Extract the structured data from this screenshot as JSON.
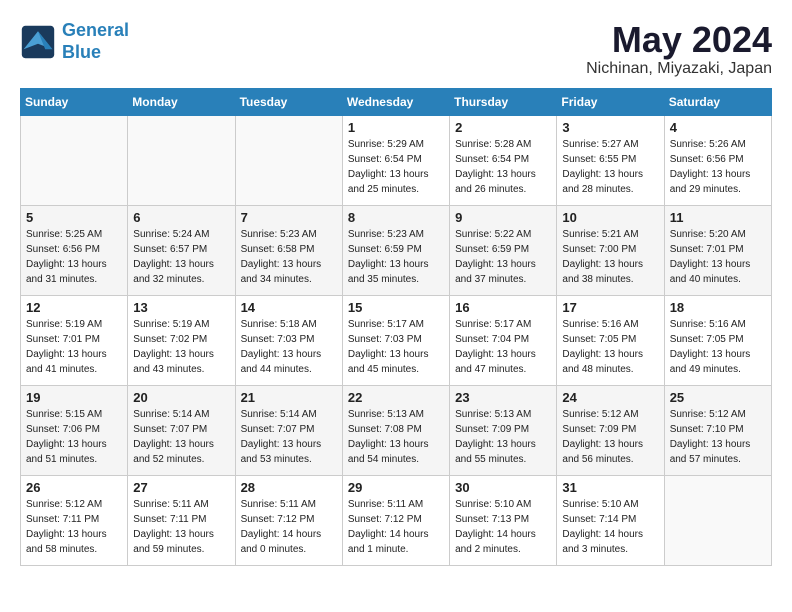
{
  "logo": {
    "line1": "General",
    "line2": "Blue"
  },
  "title": {
    "month_year": "May 2024",
    "location": "Nichinan, Miyazaki, Japan"
  },
  "weekdays": [
    "Sunday",
    "Monday",
    "Tuesday",
    "Wednesday",
    "Thursday",
    "Friday",
    "Saturday"
  ],
  "weeks": [
    [
      {
        "day": "",
        "info": ""
      },
      {
        "day": "",
        "info": ""
      },
      {
        "day": "",
        "info": ""
      },
      {
        "day": "1",
        "info": "Sunrise: 5:29 AM\nSunset: 6:54 PM\nDaylight: 13 hours\nand 25 minutes."
      },
      {
        "day": "2",
        "info": "Sunrise: 5:28 AM\nSunset: 6:54 PM\nDaylight: 13 hours\nand 26 minutes."
      },
      {
        "day": "3",
        "info": "Sunrise: 5:27 AM\nSunset: 6:55 PM\nDaylight: 13 hours\nand 28 minutes."
      },
      {
        "day": "4",
        "info": "Sunrise: 5:26 AM\nSunset: 6:56 PM\nDaylight: 13 hours\nand 29 minutes."
      }
    ],
    [
      {
        "day": "5",
        "info": "Sunrise: 5:25 AM\nSunset: 6:56 PM\nDaylight: 13 hours\nand 31 minutes."
      },
      {
        "day": "6",
        "info": "Sunrise: 5:24 AM\nSunset: 6:57 PM\nDaylight: 13 hours\nand 32 minutes."
      },
      {
        "day": "7",
        "info": "Sunrise: 5:23 AM\nSunset: 6:58 PM\nDaylight: 13 hours\nand 34 minutes."
      },
      {
        "day": "8",
        "info": "Sunrise: 5:23 AM\nSunset: 6:59 PM\nDaylight: 13 hours\nand 35 minutes."
      },
      {
        "day": "9",
        "info": "Sunrise: 5:22 AM\nSunset: 6:59 PM\nDaylight: 13 hours\nand 37 minutes."
      },
      {
        "day": "10",
        "info": "Sunrise: 5:21 AM\nSunset: 7:00 PM\nDaylight: 13 hours\nand 38 minutes."
      },
      {
        "day": "11",
        "info": "Sunrise: 5:20 AM\nSunset: 7:01 PM\nDaylight: 13 hours\nand 40 minutes."
      }
    ],
    [
      {
        "day": "12",
        "info": "Sunrise: 5:19 AM\nSunset: 7:01 PM\nDaylight: 13 hours\nand 41 minutes."
      },
      {
        "day": "13",
        "info": "Sunrise: 5:19 AM\nSunset: 7:02 PM\nDaylight: 13 hours\nand 43 minutes."
      },
      {
        "day": "14",
        "info": "Sunrise: 5:18 AM\nSunset: 7:03 PM\nDaylight: 13 hours\nand 44 minutes."
      },
      {
        "day": "15",
        "info": "Sunrise: 5:17 AM\nSunset: 7:03 PM\nDaylight: 13 hours\nand 45 minutes."
      },
      {
        "day": "16",
        "info": "Sunrise: 5:17 AM\nSunset: 7:04 PM\nDaylight: 13 hours\nand 47 minutes."
      },
      {
        "day": "17",
        "info": "Sunrise: 5:16 AM\nSunset: 7:05 PM\nDaylight: 13 hours\nand 48 minutes."
      },
      {
        "day": "18",
        "info": "Sunrise: 5:16 AM\nSunset: 7:05 PM\nDaylight: 13 hours\nand 49 minutes."
      }
    ],
    [
      {
        "day": "19",
        "info": "Sunrise: 5:15 AM\nSunset: 7:06 PM\nDaylight: 13 hours\nand 51 minutes."
      },
      {
        "day": "20",
        "info": "Sunrise: 5:14 AM\nSunset: 7:07 PM\nDaylight: 13 hours\nand 52 minutes."
      },
      {
        "day": "21",
        "info": "Sunrise: 5:14 AM\nSunset: 7:07 PM\nDaylight: 13 hours\nand 53 minutes."
      },
      {
        "day": "22",
        "info": "Sunrise: 5:13 AM\nSunset: 7:08 PM\nDaylight: 13 hours\nand 54 minutes."
      },
      {
        "day": "23",
        "info": "Sunrise: 5:13 AM\nSunset: 7:09 PM\nDaylight: 13 hours\nand 55 minutes."
      },
      {
        "day": "24",
        "info": "Sunrise: 5:12 AM\nSunset: 7:09 PM\nDaylight: 13 hours\nand 56 minutes."
      },
      {
        "day": "25",
        "info": "Sunrise: 5:12 AM\nSunset: 7:10 PM\nDaylight: 13 hours\nand 57 minutes."
      }
    ],
    [
      {
        "day": "26",
        "info": "Sunrise: 5:12 AM\nSunset: 7:11 PM\nDaylight: 13 hours\nand 58 minutes."
      },
      {
        "day": "27",
        "info": "Sunrise: 5:11 AM\nSunset: 7:11 PM\nDaylight: 13 hours\nand 59 minutes."
      },
      {
        "day": "28",
        "info": "Sunrise: 5:11 AM\nSunset: 7:12 PM\nDaylight: 14 hours\nand 0 minutes."
      },
      {
        "day": "29",
        "info": "Sunrise: 5:11 AM\nSunset: 7:12 PM\nDaylight: 14 hours\nand 1 minute."
      },
      {
        "day": "30",
        "info": "Sunrise: 5:10 AM\nSunset: 7:13 PM\nDaylight: 14 hours\nand 2 minutes."
      },
      {
        "day": "31",
        "info": "Sunrise: 5:10 AM\nSunset: 7:14 PM\nDaylight: 14 hours\nand 3 minutes."
      },
      {
        "day": "",
        "info": ""
      }
    ]
  ]
}
